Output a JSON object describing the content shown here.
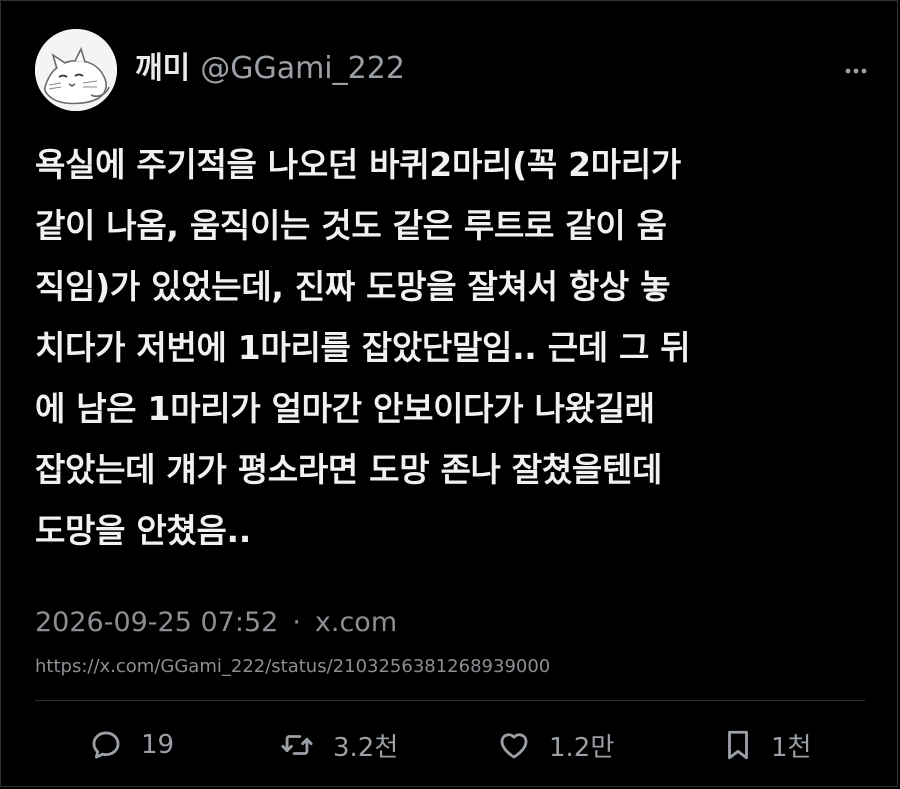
{
  "author": {
    "display_name": "깨미",
    "handle": "@GGami_222"
  },
  "tweet": {
    "text": "욕실에 주기적을 나오던 바퀴2마리(꼭 2마리가\n같이 나옴, 움직이는 것도 같은 루트로 같이 움\n직임)가 있었는데, 진짜 도망을 잘쳐서 항상 놓\n치다가 저번에 1마리를 잡았단말임.. 근데 그 뒤\n에 남은 1마리가 얼마간 안보이다가 나왔길래\n잡았는데 걔가 평소라면 도망 존나 잘쳤을텐데\n도망을 안쳤음..",
    "timestamp": "2026-09-25 07:52",
    "separator": "·",
    "source": "x.com",
    "url": "https://x.com/GGami_222/status/2103256381268939000"
  },
  "actions": {
    "reply": {
      "icon": "reply-icon",
      "count": "19"
    },
    "retweet": {
      "icon": "retweet-icon",
      "count": "3.2천"
    },
    "like": {
      "icon": "heart-icon",
      "count": "1.2만"
    },
    "bookmark": {
      "icon": "bookmark-icon",
      "count": "1천"
    }
  },
  "menu": {
    "icon": "more-options-icon"
  },
  "colors": {
    "background": "#000000",
    "text": "#e7e9ea",
    "muted": "#8b8f94",
    "divider": "#2f3336"
  }
}
